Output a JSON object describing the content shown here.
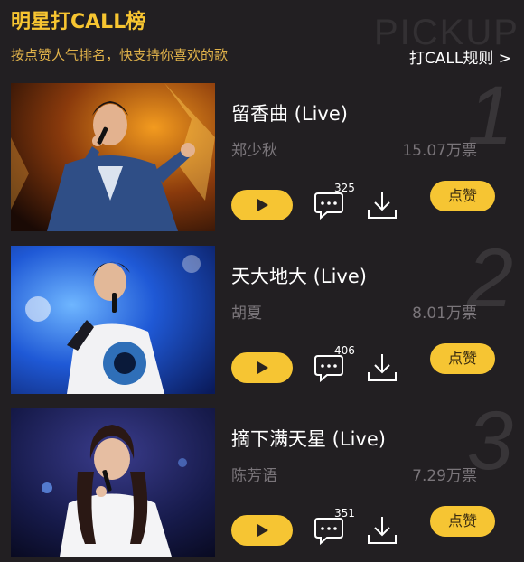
{
  "header": {
    "title": "明星打CALL榜",
    "subtitle": "按点赞人气排名，快支持你喜欢的歌",
    "rules_link": "打CALL规则 >",
    "watermark": "PICKUP"
  },
  "songs": [
    {
      "rank": "1",
      "title": "留香曲 (Live)",
      "artist": "郑少秋",
      "votes": "15.07万票",
      "comments": "325",
      "like_label": "点赞"
    },
    {
      "rank": "2",
      "title": "天大地大 (Live)",
      "artist": "胡夏",
      "votes": "8.01万票",
      "comments": "406",
      "like_label": "点赞"
    },
    {
      "rank": "3",
      "title": "摘下满天星 (Live)",
      "artist": "陈芳语",
      "votes": "7.29万票",
      "comments": "351",
      "like_label": "点赞"
    }
  ],
  "colors": {
    "accent": "#f6c533",
    "background": "#221f22",
    "muted": "#7a757a"
  },
  "icons": [
    "play-icon",
    "comment-icon",
    "download-icon"
  ]
}
